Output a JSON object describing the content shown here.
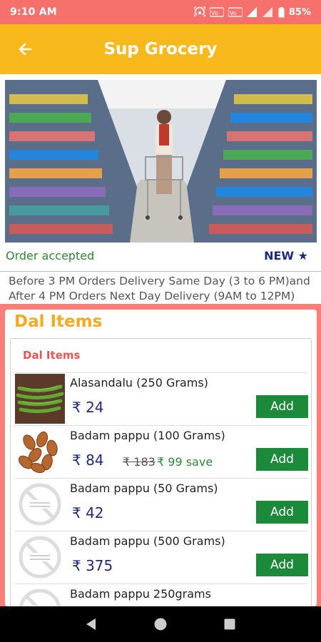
{
  "status_bar": {
    "time": "9:10 AM",
    "battery": "85%"
  },
  "app_bar": {
    "title": "Sup Grocery"
  },
  "banner": {
    "order_status": "Order accepted",
    "new_label": "NEW ★",
    "notice": "Before 3 PM Orders Delivery Same Day (3 to 6 PM)and After 4 PM Orders Next Day Delivery (9AM to 12PM)"
  },
  "section": {
    "title": "Dal Items",
    "subtitle": "Dal Items",
    "items": [
      {
        "name": "Alasandalu (250 Grams)",
        "price": "₹ 24",
        "mrp": "",
        "save": "",
        "add_label": "Add",
        "thumb": "beans-icon"
      },
      {
        "name": "Badam pappu (100 Grams)",
        "price": "₹ 84",
        "mrp": "₹ 183",
        "save": "₹ 99 save",
        "add_label": "Add",
        "thumb": "almonds-icon"
      },
      {
        "name": "Badam pappu (50 Grams)",
        "price": "₹ 42",
        "mrp": "",
        "save": "",
        "add_label": "Add",
        "thumb": "no-image-icon"
      },
      {
        "name": "Badam pappu (500 Grams)",
        "price": "₹ 375",
        "mrp": "",
        "save": "",
        "add_label": "Add",
        "thumb": "no-image-icon"
      },
      {
        "name": "Badam pappu 250grams",
        "price": "",
        "mrp": "",
        "save": "",
        "add_label": "",
        "thumb": "no-image-icon"
      }
    ]
  },
  "colors": {
    "status_bar": "#f6716b",
    "app_bar": "#f7b91c",
    "background": "#fa7f7a",
    "section_title": "#f7a91c",
    "subtitle": "#ef5350",
    "price": "#1f2a78",
    "save": "#2b8a2e",
    "add_button": "#1b8a3a"
  }
}
